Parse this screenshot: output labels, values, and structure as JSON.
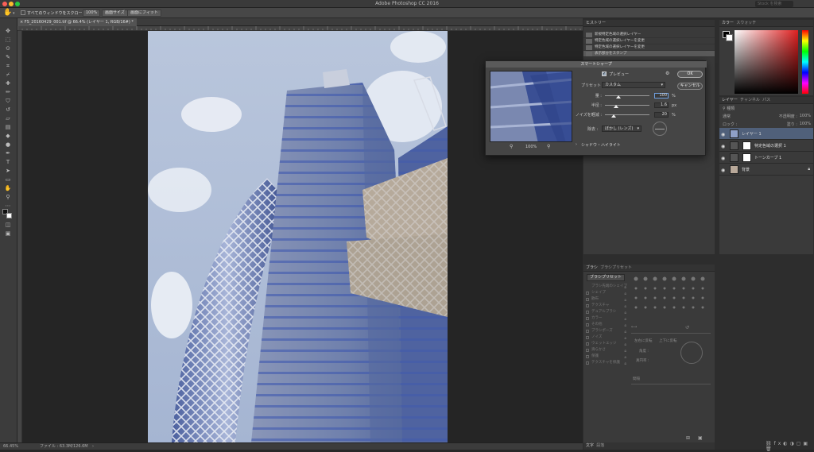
{
  "app": {
    "title": "Adobe Photoshop CC 2016",
    "search_placeholder": "Stock を検索"
  },
  "options_bar": {
    "scroll_all_label": "すべてのウィンドウをスクロール",
    "zoom_label": "100%",
    "fit_screen_label": "画面サイズ",
    "fill_screen_label": "画面にフィット"
  },
  "document": {
    "tab_title": "FS_20160429_001.tif @ 66.4% (レイヤー 1, RGB/16#) *"
  },
  "status": {
    "zoom": "66.45%",
    "file_info": "ファイル : 63.3M/126.6M"
  },
  "history": {
    "title": "ヒストリー",
    "items": [
      "新規特定色域の選択レイヤー",
      "特定色域の選択レイヤーを変更",
      "特定色域の選択レイヤーを変更",
      "表示部分をスタンプ"
    ]
  },
  "color_panel": {
    "tabs": [
      "カラー",
      "スウォッチ"
    ]
  },
  "layers_panel": {
    "tabs": [
      "レイヤー",
      "チャンネル",
      "パス"
    ],
    "kind_label": "種類",
    "mode_label": "通常",
    "opacity_label": "不透明度 :",
    "opacity_value": "100%",
    "lock_label": "ロック :",
    "fill_label": "塗り :",
    "fill_value": "100%",
    "layers": [
      {
        "name": "レイヤー 1",
        "has_mask": false
      },
      {
        "name": "特定色域の選択 1",
        "has_mask": true
      },
      {
        "name": "トーンカーブ 1",
        "has_mask": true
      },
      {
        "name": "背景",
        "has_mask": false
      }
    ]
  },
  "brush_panel": {
    "tabs": [
      "ブラシ",
      "ブラシプリセット"
    ],
    "preset_button": "ブラシプリセット",
    "items": [
      "ブラシ先端のシェイプ",
      "シェイプ",
      "散布",
      "テクスチャ",
      "デュアルブラシ",
      "カラー",
      "その他",
      "ブラシポーズ",
      "ノイズ",
      "ウェットエッジ",
      "滑らかさ",
      "保護",
      "テクスチャを保護"
    ],
    "angle_labels": [
      "左右に反転",
      "上下に反転",
      "角度 :",
      "真円率 :"
    ],
    "spacing_label": "間隔"
  },
  "bottom_tabs": [
    "文字",
    "段落"
  ],
  "dialog": {
    "title": "スマートシャープ",
    "preview_label": "プレビュー",
    "ok_label": "OK",
    "cancel_label": "キャンセル",
    "preset_label": "プリセット :",
    "preset_value": "カスタム",
    "zoom_value": "100%",
    "sliders": [
      {
        "label": "量 :",
        "value": "100",
        "unit": "%",
        "fraction": 0.3
      },
      {
        "label": "半径 :",
        "value": "1.6",
        "unit": "px",
        "fraction": 0.25
      },
      {
        "label": "ノイズを軽減 :",
        "value": "20",
        "unit": "%",
        "fraction": 0.2
      }
    ],
    "remove_label": "除去 :",
    "remove_value": "ぼかし (レンズ)",
    "shadow_highlight_label": "シャドウ・ハイライト"
  }
}
